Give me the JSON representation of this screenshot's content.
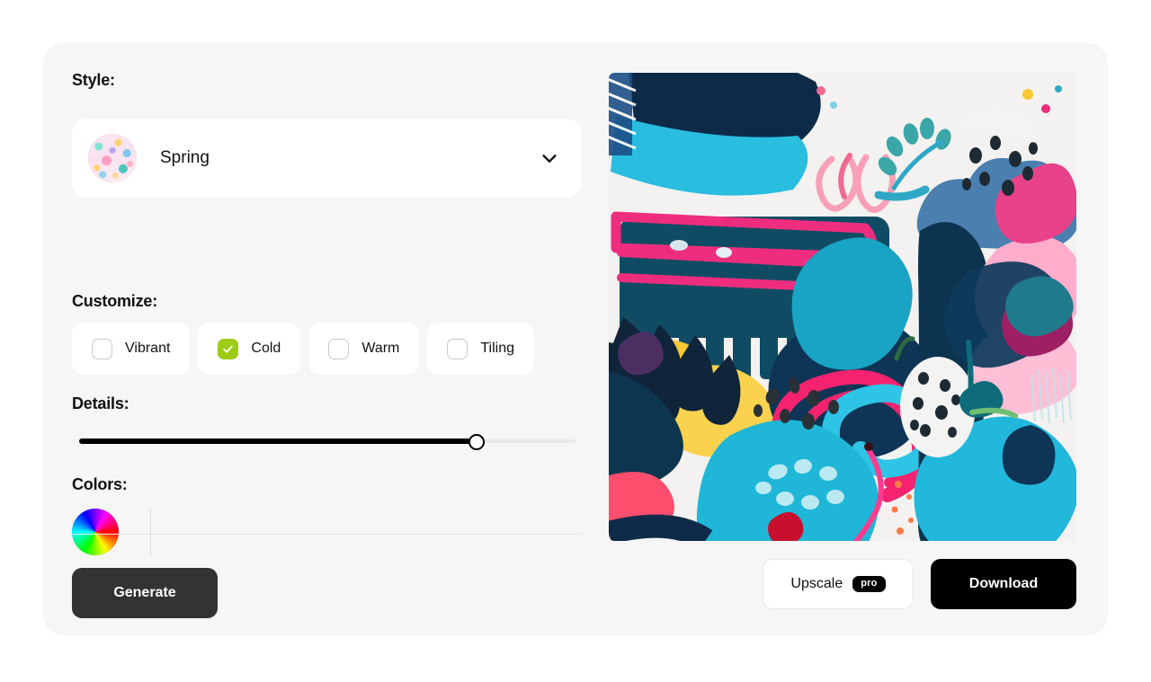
{
  "panel": {
    "style": {
      "label": "Style:",
      "selected": "Spring",
      "thumbnail_icon": "style-thumbnail-spring",
      "chevron_icon": "chevron-down-icon"
    },
    "customize": {
      "label": "Customize:",
      "options": [
        {
          "label": "Vibrant",
          "checked": false
        },
        {
          "label": "Cold",
          "checked": true
        },
        {
          "label": "Warm",
          "checked": false
        },
        {
          "label": "Tiling",
          "checked": false
        }
      ],
      "checked_color": "#9dcc14"
    },
    "details": {
      "label": "Details:",
      "value_percent": 80,
      "min": 0,
      "max": 100
    },
    "colors": {
      "label": "Colors:",
      "wheel_icon": "color-wheel-icon"
    },
    "generate_button": "Generate"
  },
  "preview": {
    "alt": "Generated abstract pattern artwork",
    "upscale_button": "Upscale",
    "pro_badge": "pro",
    "download_button": "Download"
  },
  "theme": {
    "card_bg": "#f6f6f6",
    "page_bg": "#ffffff",
    "accent_green": "#9dcc14",
    "generate_bg": "#333333",
    "download_bg": "#000000"
  }
}
